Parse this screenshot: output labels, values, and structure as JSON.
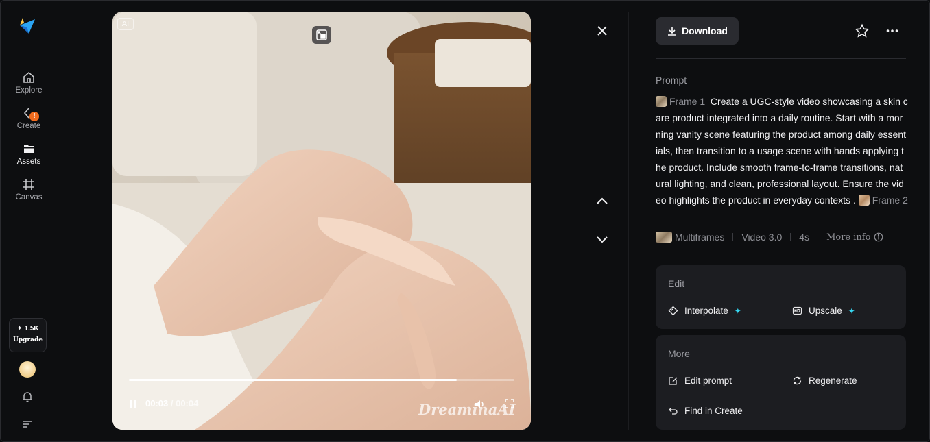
{
  "sidebar": {
    "items": [
      {
        "label": "Explore",
        "icon": "home-icon"
      },
      {
        "label": "Create",
        "icon": "create-icon",
        "badge": "!"
      },
      {
        "label": "Assets",
        "icon": "folder-icon"
      },
      {
        "label": "Canvas",
        "icon": "canvas-icon"
      }
    ],
    "upgrade": {
      "credits": "✦ 1.5K",
      "label": "Upgrade"
    }
  },
  "video": {
    "ai_tag": "AI",
    "current_time": "00:03",
    "duration": "/ 00:04",
    "progress": 0.85,
    "watermark": "DreaminaAI"
  },
  "panel": {
    "download_label": "Download",
    "prompt_heading": "Prompt",
    "frame1_label": "Frame 1",
    "prompt_text": "Create a UGC-style video showcasing a skin care product integrated into a daily routine. Start with a morning vanity scene featuring the product among daily essentials, then transition to a usage scene with hands applying the product. Include smooth frame-to-frame transitions, natural lighting, and clean, professional layout. Ensure the video highlights the product in everyday contexts .",
    "frame2_label": "Frame 2",
    "meta": {
      "type": "Multiframes",
      "model": "Video 3.0",
      "length": "4s",
      "more_info": "More info"
    },
    "edit_card": {
      "heading": "Edit",
      "interpolate": "Interpolate",
      "upscale": "Upscale",
      "spark": "✦"
    },
    "more_card": {
      "heading": "More",
      "edit_prompt": "Edit prompt",
      "regenerate": "Regenerate",
      "find_in_create": "Find in Create"
    }
  },
  "colors": {
    "background": "#0d0e10",
    "card": "#1c1d21",
    "accent_spark": "#36d6f0",
    "badge": "#f26b1d"
  }
}
